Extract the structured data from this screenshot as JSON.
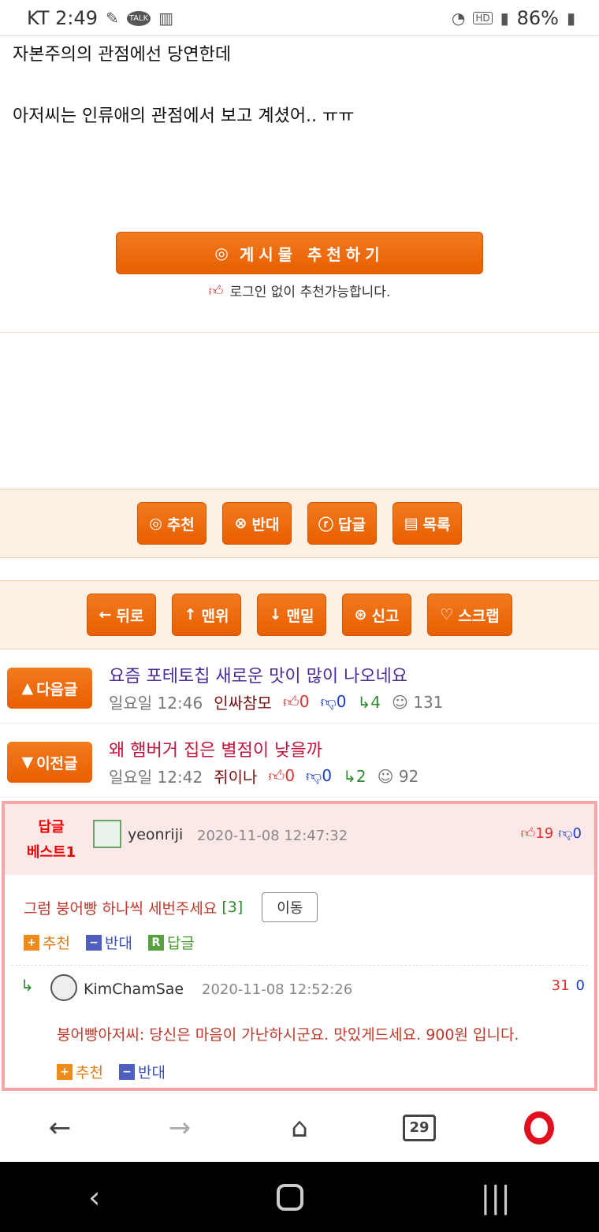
{
  "status": {
    "carrier_time": "KT 2:49",
    "battery": "86%",
    "icons": [
      "pill-icon",
      "talk-icon",
      "chart-search-icon",
      "wifi-icon",
      "hd-icon",
      "signal-icon",
      "battery-icon"
    ],
    "talk": "TALK",
    "hd": "HD"
  },
  "article": {
    "line1": "자본주의의 관점에선 당연한데",
    "line2": "아저씨는 인류애의 관점에서 보고 계셨어.. ㅠㅠ"
  },
  "recommend": {
    "button_label": "게시물 추천하기",
    "note": "로그인 없이 추천가능합니다."
  },
  "actions1": [
    "추천",
    "반대",
    "답글",
    "목록"
  ],
  "actions2": [
    "뒤로",
    "맨위",
    "맨밑",
    "신고",
    "스크랩"
  ],
  "next_post": {
    "tag": "다음글",
    "title": "요즘 포테토칩 새로운 맛이 많이 나오네요",
    "time": "일요일 12:46",
    "author": "인싸참모",
    "up": "0",
    "down": "0",
    "replies": "4",
    "views": "131"
  },
  "prev_post": {
    "tag": "이전글",
    "title": "왜 햄버거 집은 별점이 낮을까",
    "time": "일요일 12:42",
    "author": "쥐이나",
    "up": "0",
    "down": "0",
    "replies": "2",
    "views": "92"
  },
  "best_comment": {
    "label1": "답글",
    "label2": "베스트1",
    "user": "yeonriji",
    "date": "2020-11-08 12:47:32",
    "up": "19",
    "down": "0",
    "text": "그럼 붕어빵 하나씩 세번주세요",
    "reply_count": "[3]",
    "move": "이동",
    "act_up": "추천",
    "act_down": "반대",
    "act_reply": "답글"
  },
  "reply": {
    "user": "KimChamSae",
    "date": "2020-11-08 12:52:26",
    "up": "31",
    "down": "0",
    "text": "붕어빵아저씨: 당신은 마음이 가난하시군요. 맛있게드세요. 900원 입니다.",
    "act_up": "추천",
    "act_down": "반대"
  },
  "browser": {
    "tabs_count": "29"
  },
  "colors": {
    "accent": "#ec6a0e",
    "best_bg": "#fde8e8",
    "best_border": "#f5a6a6"
  }
}
